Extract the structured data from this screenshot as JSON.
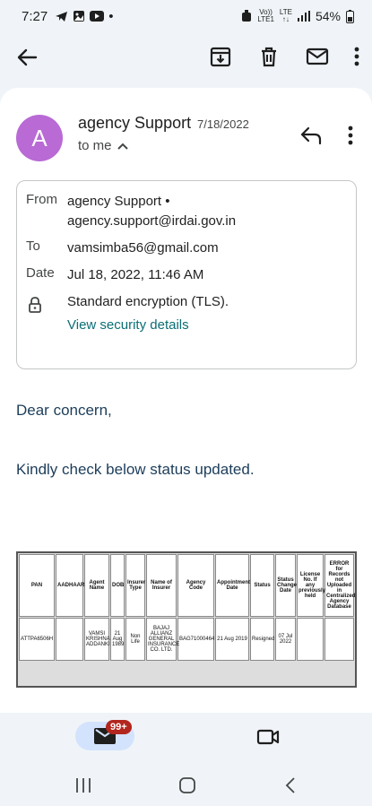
{
  "status_bar": {
    "time": "7:27",
    "dot": "•",
    "net_top": "Vo))",
    "net_bottom": "LTE1",
    "lte_top": "LTE",
    "lte_bottom": "↑↓",
    "battery": "54%"
  },
  "toolbar": {
    "back_icon": "arrow-left-icon",
    "archive_icon": "archive-icon",
    "delete_icon": "trash-icon",
    "mark_unread_icon": "mail-icon",
    "more_icon": "more-vert-icon"
  },
  "email": {
    "avatar_letter": "A",
    "sender": "agency Support",
    "date": "7/18/2022",
    "to_me": "to me",
    "details": {
      "from_label": "From",
      "from_value": "agency Support • agency.support@irdai.gov.in",
      "to_label": "To",
      "to_value": "vamsimba56@gmail.com",
      "date_label": "Date",
      "date_value": "Jul 18, 2022, 11:46 AM",
      "encryption": "Standard encryption (TLS).",
      "security_link": "View security details"
    },
    "greeting": "Dear concern,",
    "body": "Kindly check below status updated."
  },
  "table": {
    "headers": [
      "PAN",
      "AADHAAR",
      "Agent Name",
      "DOB",
      "Insurer Type",
      "Name of Insurer",
      "Agency Code",
      "Appointment Date",
      "Status",
      "Status Change Date",
      "License No. If any previously held",
      "ERROR for Records not Uploaded in Centralized Agency Database"
    ],
    "row": [
      "ATTPA6506H",
      "",
      "VAMSI KRISHNA ADDANKI",
      "21 Aug 1989",
      "Non Life",
      "BAJAJ ALLIANZ GENERAL INSURANCE CO. LTD.",
      "BAG71000464",
      "21 Aug 2019",
      "Resigned",
      "07 Jul 2022",
      "",
      ""
    ]
  },
  "bottom_nav": {
    "mail_badge": "99+",
    "accent": "#d3e3fd",
    "badge_color": "#b3261e"
  }
}
